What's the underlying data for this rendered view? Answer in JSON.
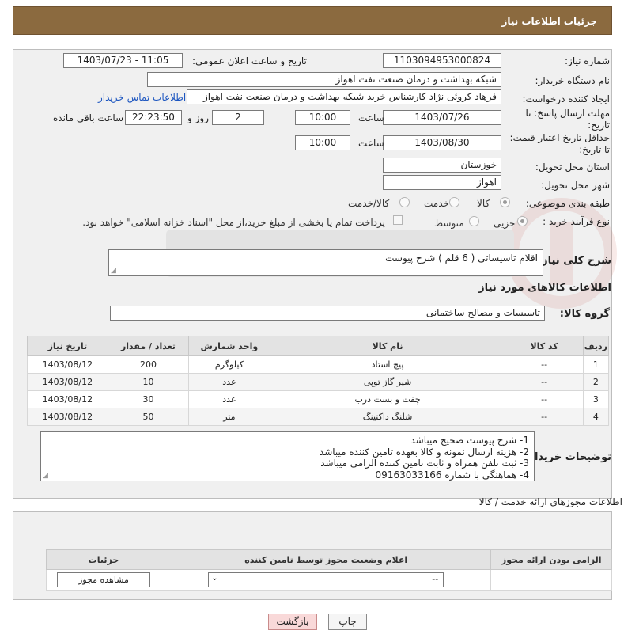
{
  "header": {
    "title": "جزئیات اطلاعات نیاز"
  },
  "form": {
    "need_number_label": "شماره نیاز:",
    "need_number": "1103094953000824",
    "announce_label": "تاریخ و ساعت اعلان عمومی:",
    "announce_value": "1403/07/23 - 11:05",
    "buyer_label": "نام دستگاه خریدار:",
    "buyer_value": "شبکه بهداشت و درمان صنعت نفت اهواز",
    "creator_label": "ایجاد کننده درخواست:",
    "creator_value": "فرهاد کروئی نژاد کارشناس خرید شبکه بهداشت و درمان صنعت نفت اهواز",
    "contact_link": "اطلاعات تماس خریدار",
    "deadline_label": "مهلت ارسال پاسخ: تا تاریخ:",
    "deadline_date": "1403/07/26",
    "time_label": "ساعت",
    "deadline_time": "10:00",
    "days_value": "2",
    "days_label": "روز و",
    "remaining_value": "22:23:50",
    "remaining_label": "ساعت باقی مانده",
    "validity_label": "حداقل تاریخ اعتبار قیمت: تا تاریخ:",
    "validity_date": "1403/08/30",
    "validity_time": "10:00",
    "province_label": "استان محل تحویل:",
    "province_value": "خوزستان",
    "city_label": "شهر محل تحویل:",
    "city_value": "اهواز",
    "category_label": "طبقه بندی موضوعی:",
    "category_options": [
      "کالا",
      "خدمت",
      "کالا/خدمت"
    ],
    "category_selected": "کالا",
    "process_label": "نوع فرآیند خرید :",
    "process_options": [
      "جزیی",
      "متوسط"
    ],
    "process_selected": "جزیی",
    "payment_note": "پرداخت تمام یا بخشی از مبلغ خرید،از محل \"اسناد خزانه اسلامی\" خواهد بود.",
    "summary_label": "شرح کلی نیاز:",
    "summary_value": "اقلام تاسیساتی ( 6 قلم ) شرح پیوست"
  },
  "goods": {
    "section_title": "اطلاعات کالاهای مورد نیاز",
    "group_label": "گروه کالا:",
    "group_value": "تاسیسات و مصالح ساختمانی",
    "columns": [
      "ردیف",
      "کد کالا",
      "نام کالا",
      "واحد شمارش",
      "تعداد / مقدار",
      "تاریخ نیاز"
    ],
    "rows": [
      [
        "1",
        "--",
        "پیچ استاد",
        "کیلوگرم",
        "200",
        "1403/08/12"
      ],
      [
        "2",
        "--",
        "شیر گاز توپی",
        "عدد",
        "10",
        "1403/08/12"
      ],
      [
        "3",
        "--",
        "چفت و بست درب",
        "عدد",
        "30",
        "1403/08/12"
      ],
      [
        "4",
        "--",
        "شلنگ داکتینگ",
        "متر",
        "50",
        "1403/08/12"
      ]
    ]
  },
  "buyer_notes": {
    "label": "توضیحات خریدار:",
    "lines": [
      "1- شرح پیوست صحیح میباشد",
      "2- هزینه ارسال نمونه و کالا بعهده تامین کننده میباشد",
      "3- ثبت تلفن همراه و ثابت تامین کننده الزامی میباشد",
      "4- هماهنگی با شماره 09163033166"
    ]
  },
  "licenses": {
    "title": "اطلاعات مجوزهای ارائه خدمت / کالا",
    "columns": [
      "الزامی بودن ارائه مجوز",
      "اعلام وضعیت مجوز توسط تامین کننده",
      "جزئیات"
    ],
    "select_value": "--",
    "view_button": "مشاهده مجوز"
  },
  "actions": {
    "print": "چاپ",
    "back": "بازگشت"
  },
  "colors": {
    "header_bg": "#8b6a3f",
    "link": "#1d56c0",
    "back_btn_bg": "#f9d9d9"
  }
}
